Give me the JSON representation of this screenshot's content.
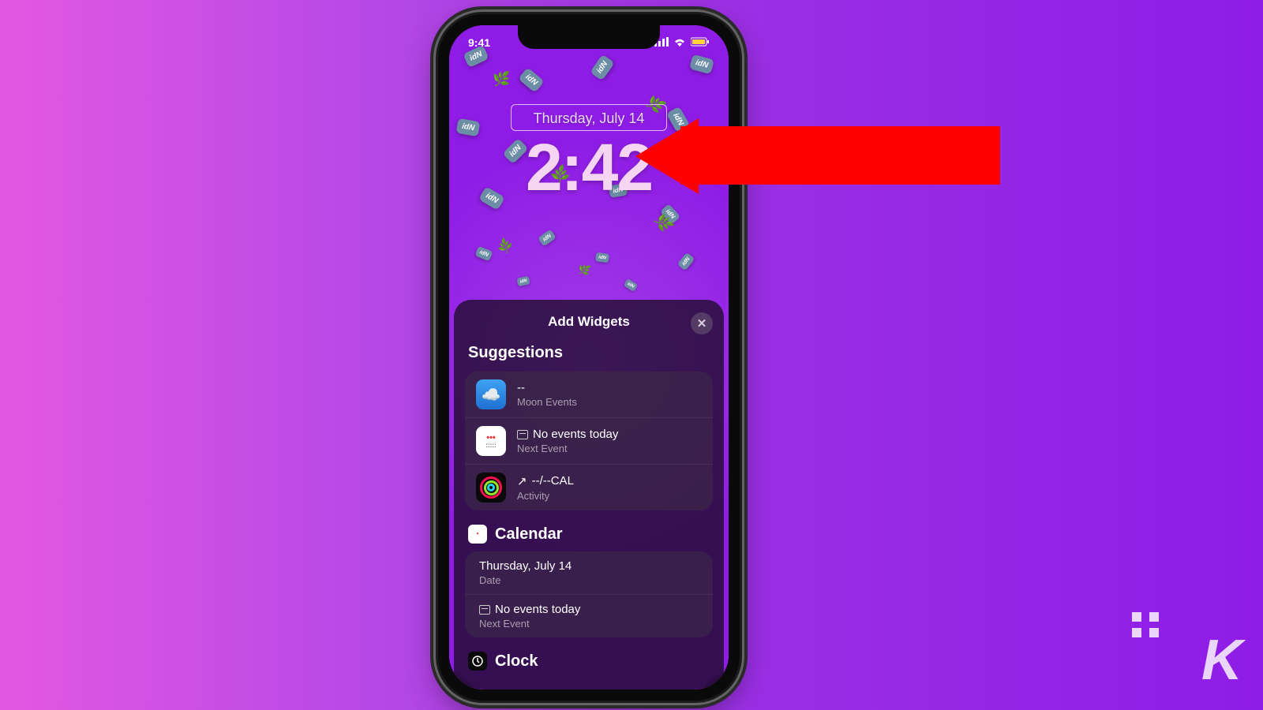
{
  "status": {
    "time": "9:41"
  },
  "lock": {
    "date": "Thursday, July 14",
    "clock": "2:42"
  },
  "sheet": {
    "title": "Add Widgets",
    "suggestions_label": "Suggestions",
    "items": [
      {
        "title": "--",
        "sub": "Moon Events"
      },
      {
        "title": "No events today",
        "sub": "Next Event"
      },
      {
        "title": "--/--CAL",
        "sub": "Activity"
      }
    ],
    "calendar_label": "Calendar",
    "calendar_items": [
      {
        "title": "Thursday, July 14",
        "sub": "Date"
      },
      {
        "title": "No events today",
        "sub": "Next Event"
      }
    ],
    "clock_label": "Clock"
  },
  "watermark": "K"
}
